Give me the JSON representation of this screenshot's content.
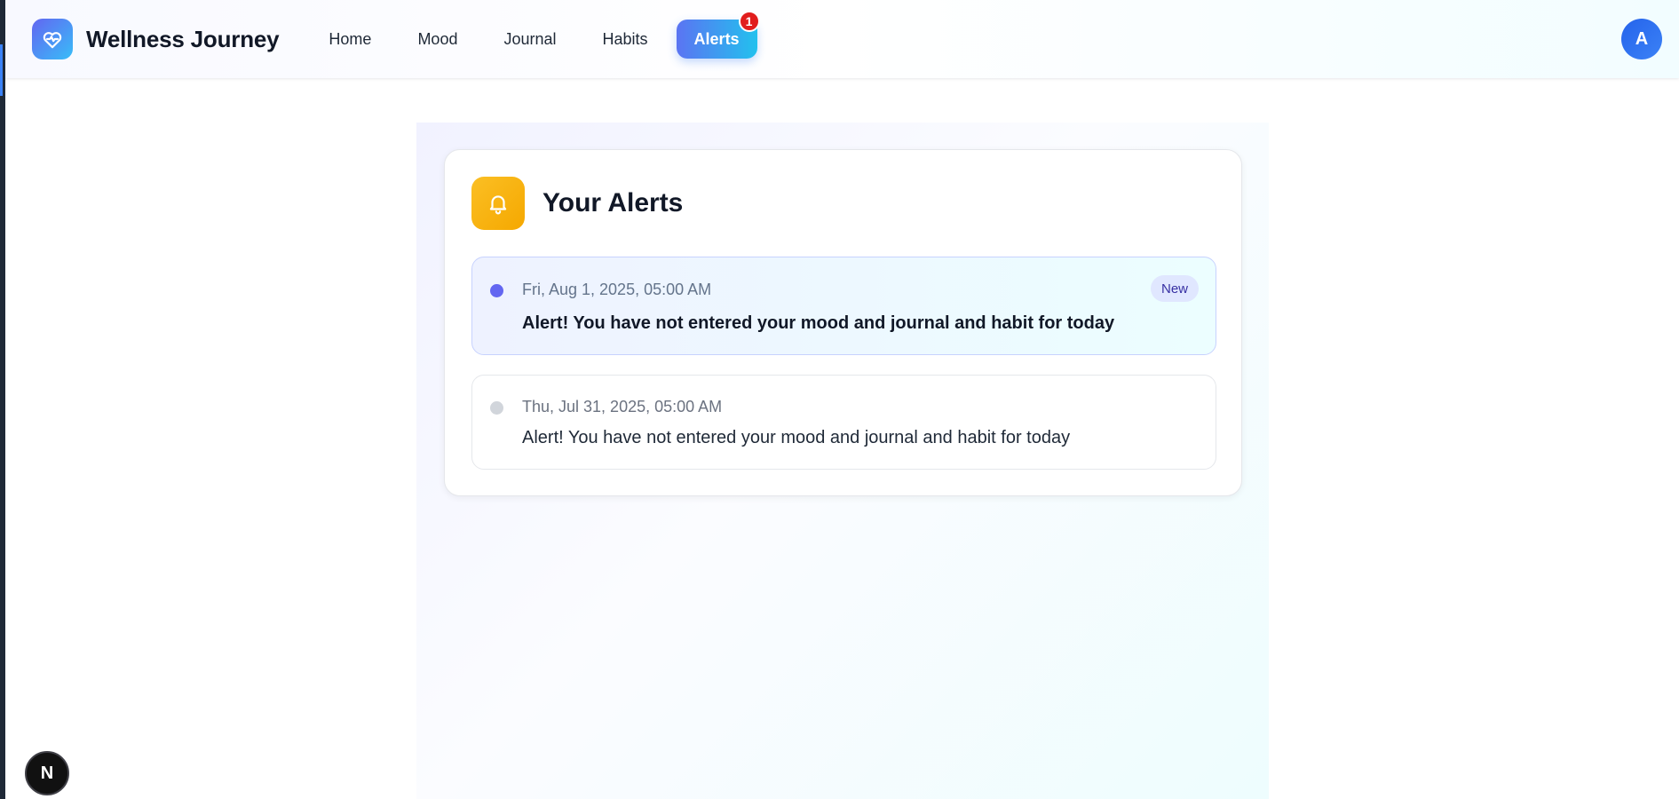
{
  "app": {
    "title": "Wellness Journey",
    "logo_icon": "heart-pulse-icon",
    "brand_colors": [
      "#6366f1",
      "#38bdf8"
    ]
  },
  "nav": {
    "items": [
      {
        "label": "Home",
        "active": false
      },
      {
        "label": "Mood",
        "active": false
      },
      {
        "label": "Journal",
        "active": false
      },
      {
        "label": "Habits",
        "active": false
      },
      {
        "label": "Alerts",
        "active": true,
        "badge": "1"
      }
    ]
  },
  "user": {
    "avatar_initial": "A"
  },
  "alerts_panel": {
    "title": "Your Alerts",
    "icon": "bell-icon",
    "icon_color": "#fbbf24",
    "items": [
      {
        "time": "Fri, Aug 1, 2025, 05:00 AM",
        "message": "Alert! You have not entered your mood and journal and habit for today",
        "status": "New",
        "unread": true
      },
      {
        "time": "Thu, Jul 31, 2025, 05:00 AM",
        "message": "Alert! You have not entered your mood and journal and habit for today",
        "unread": false
      }
    ]
  },
  "dev_indicator": {
    "label": "N"
  }
}
